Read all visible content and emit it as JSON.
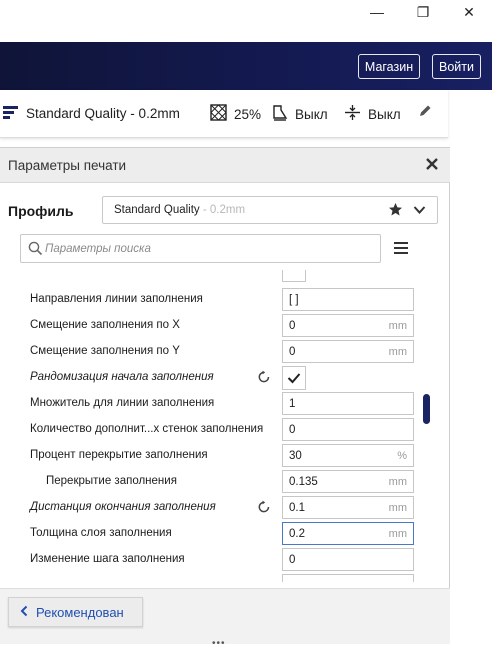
{
  "window": {
    "minimize_glyph": "—",
    "maximize_glyph": "❐",
    "close_glyph": "✕"
  },
  "header": {
    "shop_label": "Магазин",
    "login_label": "Войти"
  },
  "settings_bar": {
    "profile": "Standard Quality - 0.2mm",
    "infill": "25%",
    "support": "Выкл",
    "adhesion": "Выкл"
  },
  "panel": {
    "title": "Параметры печати",
    "profile_label": "Профиль",
    "profile_name": "Standard Quality",
    "profile_layer": " - 0.2mm",
    "search_placeholder": "Параметры поиска",
    "footer_button": "Рекомендован",
    "drag_glyph": "•••"
  },
  "rows": [
    {
      "label": "Направления линии заполнения",
      "value": "[ ]",
      "unit": ""
    },
    {
      "label": "Смещение заполнения по X",
      "value": "0",
      "unit": "mm"
    },
    {
      "label": "Смещение заполнения по Y",
      "value": "0",
      "unit": "mm"
    },
    {
      "label": "Рандомизация начала заполнения",
      "checked": true
    },
    {
      "label": "Множитель для линии заполнения",
      "value": "1",
      "unit": ""
    },
    {
      "label": "Количество дополнит...х стенок заполнения",
      "value": "0",
      "unit": ""
    },
    {
      "label": "Процент перекрытие заполнения",
      "value": "30",
      "unit": "%"
    },
    {
      "label": "Перекрытие заполнения",
      "value": "0.135",
      "unit": "mm"
    },
    {
      "label": "Дистанция окончания заполнения",
      "value": "0.1",
      "unit": "mm"
    },
    {
      "label": "Толщина слоя заполнения",
      "value": "0.2",
      "unit": "mm"
    },
    {
      "label": "Изменение шага заполнения",
      "value": "0",
      "unit": ""
    }
  ],
  "colors": {
    "header_dark": "#141a52",
    "accent_blue": "#1f4fb0",
    "focus_border": "#4a78c8"
  }
}
